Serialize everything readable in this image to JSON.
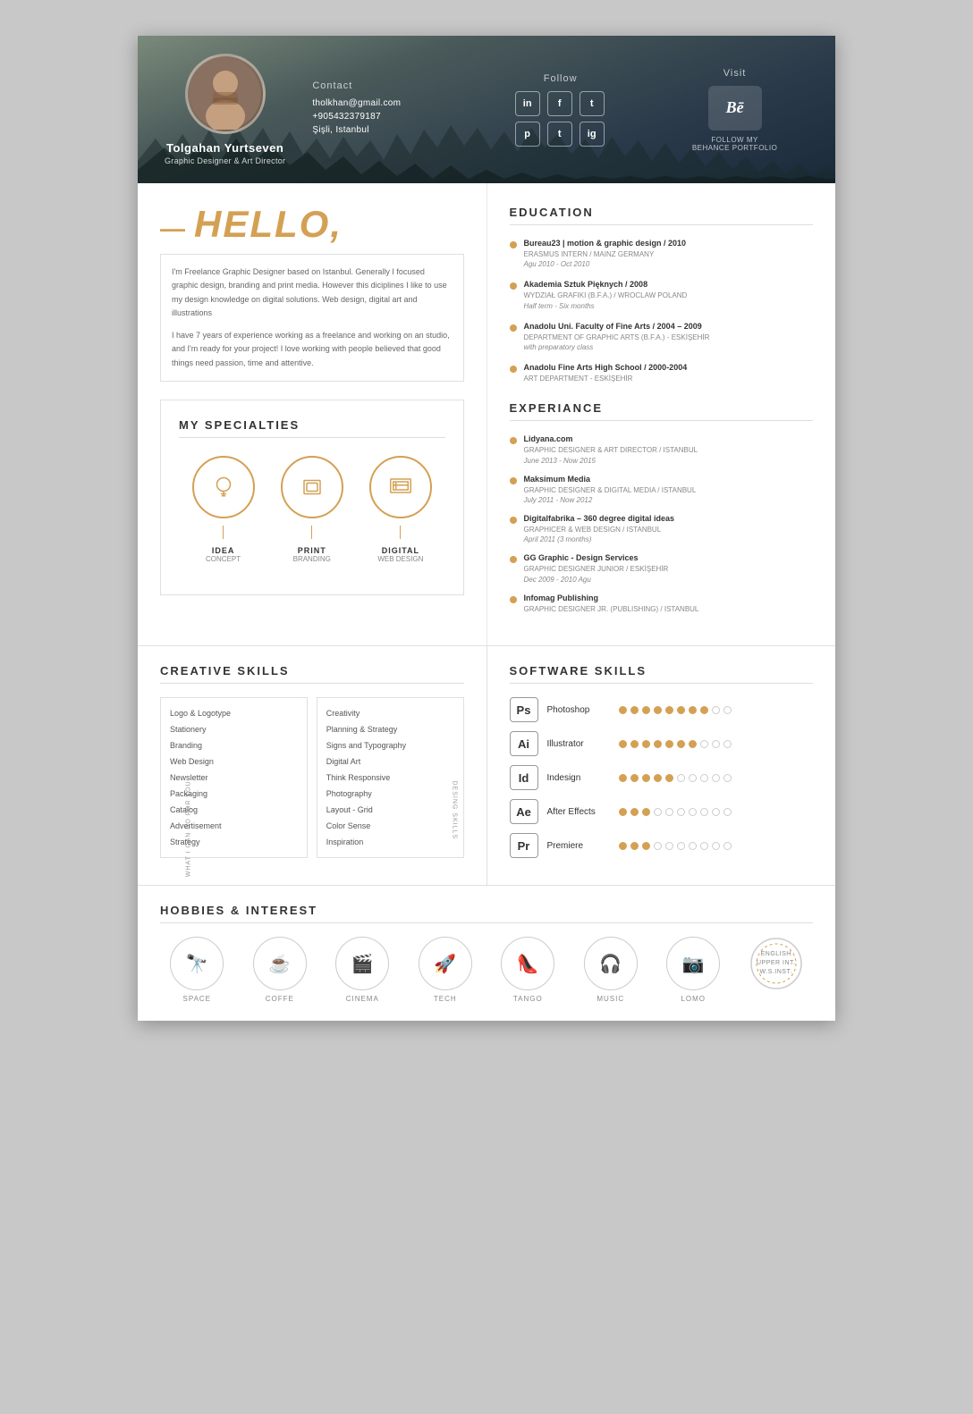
{
  "header": {
    "name": "Tolgahan Yurtseven",
    "title": "Graphic Designer & Art Director",
    "contact_label": "Contact",
    "email": "tholkhan@gmail.com",
    "phone": "+905432379187",
    "address": "Şişli, Istanbul",
    "follow_label": "Follow",
    "visit_label": "Visit",
    "behance_label": "FOLLOW MY\nBEHANCE PORTFOLIO",
    "social": [
      "in",
      "f",
      "t",
      "p",
      "t",
      "ig"
    ]
  },
  "hello": {
    "title": "HELLO,",
    "dash": "—",
    "bio1": "I'm Freelance Graphic Designer based on Istanbul. Generally I focused graphic design, branding and print media. However this diciplines I like to use my design knowledge on digital solutions. Web design, digital art and illustrations",
    "bio2": "I have 7 years of experience working as a freelance and working on an studio, and I'm ready for your project! I love working with people believed that good things need passion, time and attentive."
  },
  "education": {
    "title": "EDUCATION",
    "items": [
      {
        "degree": "Bureau23 | motion & graphic design / 2010",
        "sub": "ERASMUS INTERN / MAINZ GERMANY",
        "date": "Agu 2010 - Oct 2010"
      },
      {
        "degree": "Akademia Sztuk Pięknych / 2008",
        "sub": "WYDZIAŁ GRAFIKI (B.F.A.) / WROCLAW POLAND",
        "date": "Half term - Six months"
      },
      {
        "degree": "Anadolu Uni. Faculty of Fine Arts / 2004 – 2009",
        "sub": "DEPARTMENT OF GRAPHIC ARTS (B.F.A.) - ESKİŞEHİR",
        "date": "with preparatory class"
      },
      {
        "degree": "Anadolu Fine Arts High School / 2000-2004",
        "sub": "ART DEPARTMENT - ESKİŞEHİR",
        "date": ""
      }
    ]
  },
  "specialties": {
    "title": "MY SPECIALTIES",
    "items": [
      {
        "icon": "💡",
        "label": "IDEA",
        "sublabel": "CONCEPT"
      },
      {
        "icon": "🖨",
        "label": "PRINT",
        "sublabel": "BRANDING"
      },
      {
        "icon": "🖥",
        "label": "DIGITAL",
        "sublabel": "WEB DESIGN"
      }
    ]
  },
  "experience": {
    "title": "EXPERIANCE",
    "items": [
      {
        "company": "Lidyana.com",
        "role": "GRAPHIC DESIGNER & ART DIRECTOR / ISTANBUL",
        "date": "June 2013 - Now 2015"
      },
      {
        "company": "Maksimum Media",
        "role": "GRAPHIC DESIGNER & DIGITAL MEDIA / ISTANBUL",
        "date": "July 2011 - Now 2012"
      },
      {
        "company": "Digitalfabrika – 360 degree digital ideas",
        "role": "GRAPHICER & WEB DESIGN / ISTANBUL",
        "date": "April 2011 (3 months)"
      },
      {
        "company": "GG Graphic - Design Services",
        "role": "GRAPHIC DESIGNER JUNIOR / ESKİŞEHİR",
        "date": "Dec 2009 - 2010 Agu"
      },
      {
        "company": "Infomag Publishing",
        "role": "GRAPHIC DESIGNER JR. (PUBLISHING) / ISTANBUL",
        "date": ""
      }
    ]
  },
  "creative_skills": {
    "title": "CREATIVE SKILLS",
    "what_label": "WHAT I CAN DO FOR YOU",
    "design_label": "DESING SKILLS",
    "list1": [
      "Logo & Logotype",
      "Stationery",
      "Branding",
      "Web Design",
      "Newsletter",
      "Packaging",
      "Catalog",
      "Advertisement",
      "Strategy"
    ],
    "list2": [
      "Creativity",
      "Planning & Strategy",
      "Signs and Typography",
      "Digital Art",
      "Think Responsive",
      "Photography",
      "Layout - Grid",
      "Color Sense",
      "Inspiration"
    ]
  },
  "software_skills": {
    "title": "SOFTWARE SKILLS",
    "items": [
      {
        "name": "Photoshop",
        "abbr": "Ps",
        "filled": 8,
        "half": 0,
        "empty": 2
      },
      {
        "name": "Illustrator",
        "abbr": "Ai",
        "filled": 7,
        "half": 0,
        "empty": 3
      },
      {
        "name": "Indesign",
        "abbr": "Id",
        "filled": 5,
        "half": 0,
        "empty": 5
      },
      {
        "name": "After Effects",
        "abbr": "Ae",
        "filled": 3,
        "half": 0,
        "empty": 7
      },
      {
        "name": "Premiere",
        "abbr": "Pr",
        "filled": 3,
        "half": 0,
        "empty": 7
      }
    ]
  },
  "hobbies": {
    "title": "HOBBIES & INTEREST",
    "items": [
      {
        "icon": "🔭",
        "label": "SPACE"
      },
      {
        "icon": "☕",
        "label": "COFFE"
      },
      {
        "icon": "🎬",
        "label": "CINEMA"
      },
      {
        "icon": "🚀",
        "label": "TECH"
      },
      {
        "icon": "👠",
        "label": "TANGO"
      },
      {
        "icon": "🎧",
        "label": "MUSIC"
      },
      {
        "icon": "📷",
        "label": "LOMO"
      },
      {
        "icon": "🌐",
        "label": "ENGLISH\nUPPER INT.\nW.S.INST."
      }
    ]
  }
}
